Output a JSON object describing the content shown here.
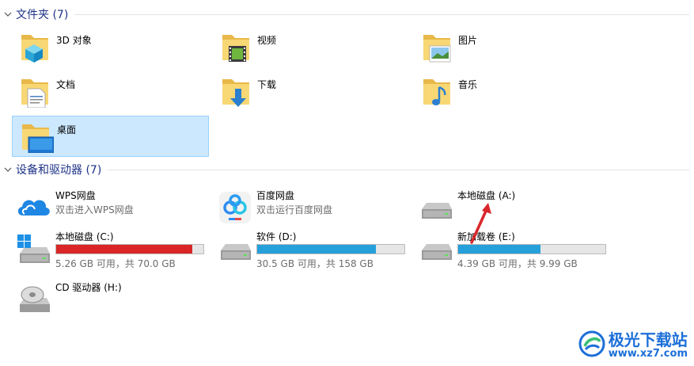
{
  "folders_group": {
    "title": "文件夹 (7)",
    "items": [
      {
        "label": "3D 对象"
      },
      {
        "label": "视频"
      },
      {
        "label": "图片"
      },
      {
        "label": "文档"
      },
      {
        "label": "下载"
      },
      {
        "label": "音乐"
      },
      {
        "label": "桌面"
      }
    ]
  },
  "devices_group": {
    "title": "设备和驱动器 (7)",
    "items": [
      {
        "label": "WPS网盘",
        "subtitle": "双击进入WPS网盘"
      },
      {
        "label": "百度网盘",
        "subtitle": "双击运行百度网盘"
      },
      {
        "label": "本地磁盘 (A:)"
      },
      {
        "label": "本地磁盘 (C:)",
        "free_text": "5.26 GB 可用，共 70.0 GB",
        "used_fraction": 0.925,
        "bar_color": "#da2626"
      },
      {
        "label": "软件 (D:)",
        "free_text": "30.5 GB 可用，共 158 GB",
        "used_fraction": 0.807,
        "bar_color": "#26a0da"
      },
      {
        "label": "新加载卷 (E:)",
        "free_text": "4.39 GB 可用，共 9.99 GB",
        "used_fraction": 0.561,
        "bar_color": "#26a0da"
      },
      {
        "label": "CD 驱动器 (H:)"
      }
    ]
  },
  "watermark": {
    "name": "极光下载站",
    "url": "www.xz7.com"
  },
  "colors": {
    "accent": "#1e3287",
    "selection": "#cce8ff",
    "selection_border": "#99d1ff",
    "annotation_arrow": "#d9262b"
  }
}
